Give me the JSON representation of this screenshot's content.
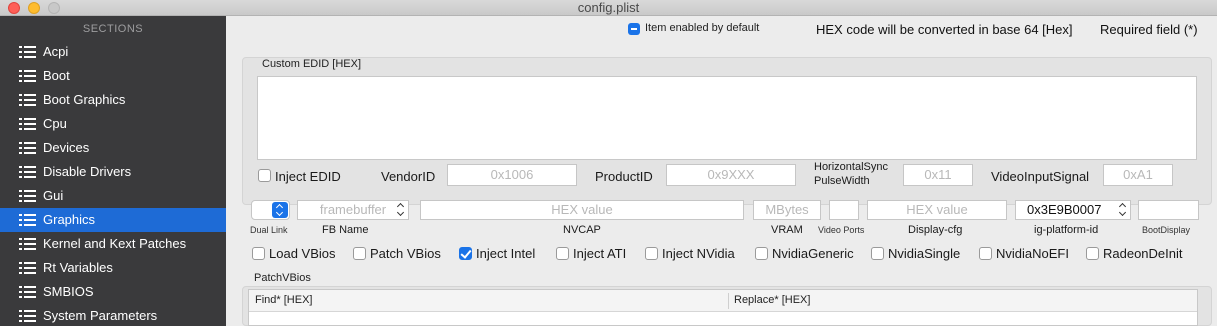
{
  "window": {
    "title": "config.plist"
  },
  "sidebar": {
    "header": "SECTIONS",
    "items": [
      {
        "label": "Acpi"
      },
      {
        "label": "Boot"
      },
      {
        "label": "Boot Graphics"
      },
      {
        "label": "Cpu"
      },
      {
        "label": "Devices"
      },
      {
        "label": "Disable Drivers"
      },
      {
        "label": "Gui"
      },
      {
        "label": "Graphics",
        "active": true
      },
      {
        "label": "Kernel and Kext Patches"
      },
      {
        "label": "Rt Variables"
      },
      {
        "label": "SMBIOS"
      },
      {
        "label": "System Parameters"
      }
    ]
  },
  "legend": {
    "enabled_default": "Item enabled by default",
    "hex_note": "HEX code will be converted in base 64 [Hex]",
    "required_note": "Required field (*)"
  },
  "edid": {
    "label": "Custom EDID [HEX]",
    "value": "",
    "inject_label": "Inject EDID",
    "inject_checked": false,
    "vendor_label": "VendorID",
    "vendor_placeholder": "0x1006",
    "product_label": "ProductID",
    "product_placeholder": "0x9XXX",
    "hsync_label_line1": "HorizontalSync",
    "hsync_label_line2": "PulseWidth",
    "hsync_placeholder": "0x11",
    "videoinput_label": "VideoInputSignal",
    "videoinput_placeholder": "0xA1"
  },
  "graphics": {
    "dual_link_label": "Dual Link",
    "fb_name_label": "FB Name",
    "fb_name_placeholder": "framebuffer",
    "nvcap_label": "NVCAP",
    "nvcap_placeholder": "HEX value",
    "vram_label": "VRAM",
    "vram_placeholder": "MBytes",
    "video_ports_label": "Video Ports",
    "display_cfg_label": "Display-cfg",
    "display_cfg_placeholder": "HEX value",
    "ig_platform_label": "ig-platform-id",
    "ig_platform_value": "0x3E9B0007",
    "boot_display_label": "BootDisplay"
  },
  "options": [
    {
      "label": "Load VBios",
      "checked": false
    },
    {
      "label": "Patch VBios",
      "checked": false
    },
    {
      "label": "Inject Intel",
      "checked": true
    },
    {
      "label": "Inject ATI",
      "checked": false
    },
    {
      "label": "Inject NVidia",
      "checked": false
    },
    {
      "label": "NvidiaGeneric",
      "checked": false
    },
    {
      "label": "NvidiaSingle",
      "checked": false
    },
    {
      "label": "NvidiaNoEFI",
      "checked": false
    },
    {
      "label": "RadeonDeInit",
      "checked": false
    }
  ],
  "patch_vbios": {
    "label": "PatchVBios",
    "columns": [
      "Find* [HEX]",
      "Replace* [HEX]"
    ]
  }
}
